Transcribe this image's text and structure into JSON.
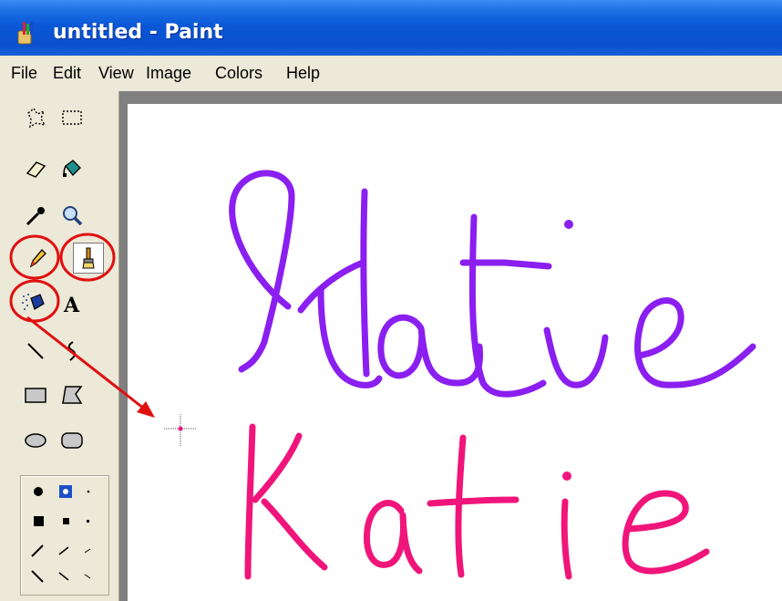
{
  "window": {
    "title": "untitled - Paint"
  },
  "menu": [
    "File",
    "Edit",
    "View",
    "Image",
    "Colors",
    "Help"
  ],
  "tools": [
    {
      "name": "free-form-select-icon"
    },
    {
      "name": "rectangle-select-icon"
    },
    {
      "name": "eraser-icon"
    },
    {
      "name": "fill-bucket-icon"
    },
    {
      "name": "eyedropper-icon"
    },
    {
      "name": "magnifier-icon"
    },
    {
      "name": "pencil-icon",
      "highlighted": true
    },
    {
      "name": "brush-icon",
      "highlighted": true
    },
    {
      "name": "airbrush-icon",
      "highlighted": true
    },
    {
      "name": "text-tool-icon"
    },
    {
      "name": "line-icon"
    },
    {
      "name": "curve-icon"
    },
    {
      "name": "rectangle-icon"
    },
    {
      "name": "polygon-icon"
    },
    {
      "name": "ellipse-icon"
    },
    {
      "name": "rounded-rectangle-icon"
    }
  ],
  "colors": {
    "title_bar": "#0a58d6",
    "face": "#ece9d8",
    "annotation": "#e01010",
    "ink_purple": "#8a1ff0",
    "ink_pink": "#f0157a"
  }
}
